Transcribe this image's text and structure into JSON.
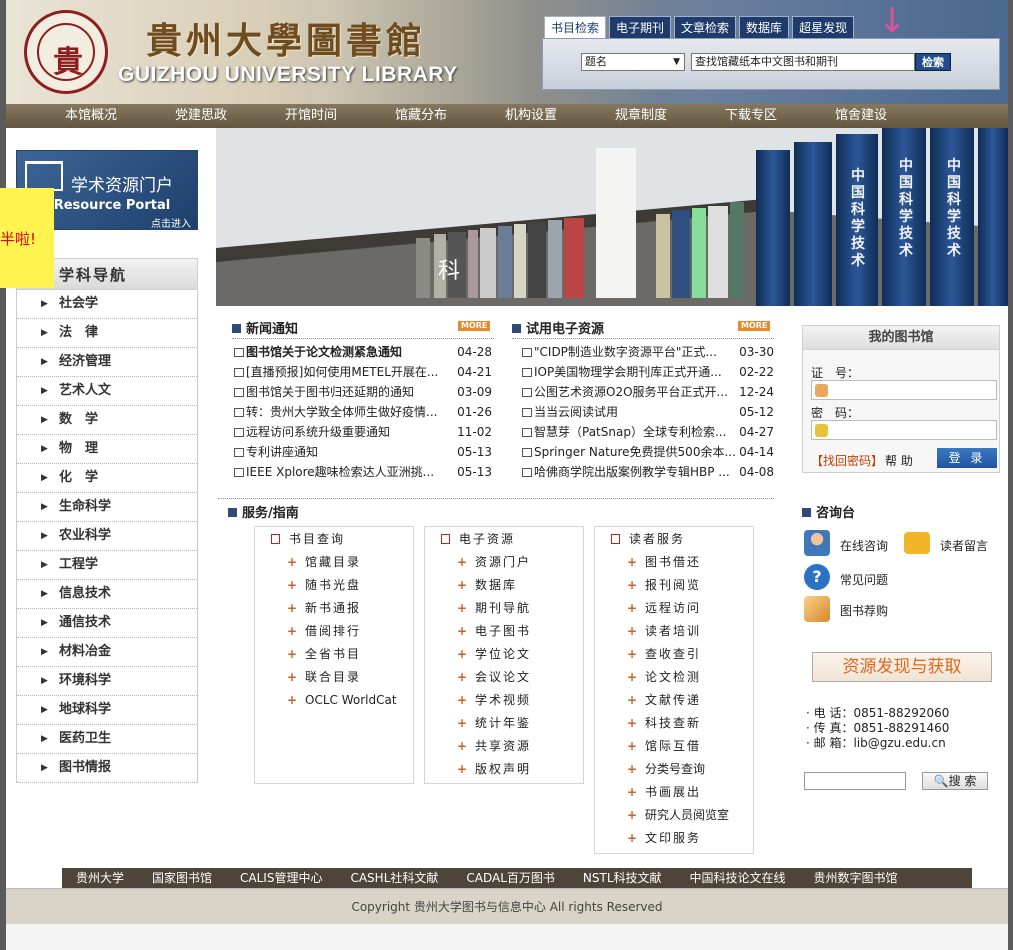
{
  "header": {
    "seal_glyph": "貴",
    "library_name_cn": "貴州大學圖書館",
    "library_name_en": "GUIZHOU UNIVERSITY LIBRARY"
  },
  "search": {
    "tabs": [
      "书目检索",
      "电子期刊",
      "文章检索",
      "数据库",
      "超星发现"
    ],
    "active_tab": 0,
    "field_select": "题名",
    "query_value": "查找馆藏纸本中文图书和期刊",
    "button_label": "检索",
    "arrow": "↓"
  },
  "nav": {
    "items": [
      "本馆概况",
      "党建思政",
      "开馆时间",
      "馆藏分布",
      "机构设置",
      "规章制度",
      "下载专区",
      "馆舍建设"
    ]
  },
  "portal": {
    "title_cn": "学术资源门户",
    "title_en": "ic Resource Portal",
    "enter": "点击进入"
  },
  "overlay_note": "半啦!",
  "subjects": {
    "heading": "学科导航",
    "items": [
      "社会学",
      "法　律",
      "经济管理",
      "艺术人文",
      "数　学",
      "物　理",
      "化　学",
      "生命科学",
      "农业科学",
      "工程学",
      "信息技术",
      "通信技术",
      "材料冶金",
      "环境科学",
      "地球科学",
      "医药卫生",
      "图书情报"
    ]
  },
  "banner": {
    "book_spines": [
      "中国科学技术",
      "中国科学技术",
      "中国科学技术"
    ],
    "shelf_text": "科"
  },
  "news": {
    "title": "新闻通知",
    "more": "MORE",
    "items": [
      {
        "text": "图书馆关于论文检测紧急通知",
        "date": "04-28",
        "bold": true
      },
      {
        "text": "[直播预报]如何使用METEL开展在...",
        "date": "04-21"
      },
      {
        "text": "图书馆关于图书归还延期的通知",
        "date": "03-09"
      },
      {
        "text": "转：贵州大学致全体师生做好疫情...",
        "date": "01-26"
      },
      {
        "text": "远程访问系统升级重要通知",
        "date": "11-02"
      },
      {
        "text": "专利讲座通知",
        "date": "05-13"
      },
      {
        "text": "IEEE Xplore趣味检索达人亚洲挑...",
        "date": "05-13"
      }
    ]
  },
  "trial": {
    "title": "试用电子资源",
    "more": "MORE",
    "items": [
      {
        "text": "\"CIDP制造业数字资源平台\"正式...",
        "date": "03-30"
      },
      {
        "text": "IOP美国物理学会期刊库正式开通...",
        "date": "02-22"
      },
      {
        "text": "公图艺术资源O2O服务平台正式开...",
        "date": "12-24"
      },
      {
        "text": "当当云阅读试用",
        "date": "05-12"
      },
      {
        "text": "智慧芽（PatSnap）全球专利检索...",
        "date": "04-27"
      },
      {
        "text": "Springer Nature免费提供500余本...",
        "date": "04-14"
      },
      {
        "text": "哈佛商学院出版案例教学专辑HBP ...",
        "date": "04-08"
      }
    ]
  },
  "services": {
    "title": "服务/指南",
    "columns": [
      {
        "head": "书目查询",
        "items": [
          "馆藏目录",
          "随书光盘",
          "新书通报",
          "借阅排行",
          "全省书目",
          "联合目录",
          "OCLC WorldCat"
        ]
      },
      {
        "head": "电子资源",
        "items": [
          "资源门户",
          "数据库",
          "期刊导航",
          "电子图书",
          "学位论文",
          "会议论文",
          "学术视频",
          "统计年鉴",
          "共享资源",
          "版权声明"
        ]
      },
      {
        "head": "读者服务",
        "items": [
          "图书借还",
          "报刊阅览",
          "远程访问",
          "读者培训",
          "查收查引",
          "论文检测",
          "文献传递",
          "科技查新",
          "馆际互借",
          "分类号查询",
          "书画展出",
          "研究人员阅览室",
          "文印服务"
        ]
      }
    ]
  },
  "mylib": {
    "title": "我的图书馆",
    "id_label": "证　号：",
    "pwd_label": "密　码：",
    "forgot": "【找回密码】",
    "help": "帮 助",
    "login": "登 录"
  },
  "consult": {
    "title": "咨询台",
    "online": "在线咨询",
    "message": "读者留言",
    "faq": "常见问题",
    "recommend": "图书荐购"
  },
  "discover_banner": "资源发现与获取",
  "contact": {
    "phone": "· 电 话：0851-88292060",
    "fax": "· 传 真：0851-88291460",
    "email": "· 邮 箱：lib@gzu.edu.cn"
  },
  "site_search": {
    "button": "搜 索"
  },
  "footer_links": [
    "贵州大学",
    "国家图书馆",
    "CALIS管理中心",
    "CASHL社科文献",
    "CADAL百万图书",
    "NSTL科技文献",
    "中国科技论文在线",
    "贵州数字图书馆"
  ],
  "copyright": "Copyright 贵州大学图书与信息中心 All rights Reserved",
  "colors": {
    "nav_bg": "#6f6450",
    "accent_blue": "#1e3b6b",
    "more_orange": "#e68a2e"
  }
}
